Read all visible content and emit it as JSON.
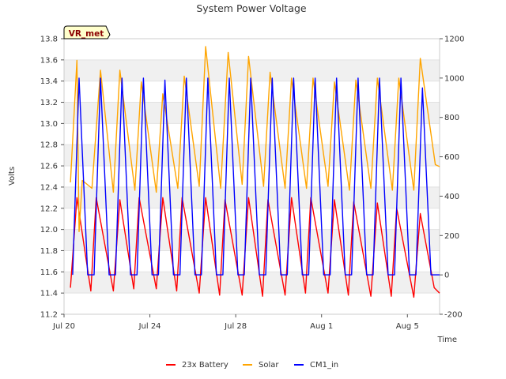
{
  "chart_data": {
    "type": "line",
    "title": "System Power Voltage",
    "xlabel": "Time",
    "ylabel": "Volts",
    "annotation": "VR_met",
    "x_ticks": [
      "Jul 20",
      "Jul 24",
      "Jul 28",
      "Aug 1",
      "Aug 5"
    ],
    "x_tick_days": [
      0,
      4,
      8,
      12,
      16
    ],
    "x_range_days": [
      0,
      17.5
    ],
    "y_left": {
      "range": [
        11.2,
        13.8
      ],
      "ticks": [
        "11.2",
        "11.4",
        "11.6",
        "11.8",
        "12.0",
        "12.2",
        "12.4",
        "12.6",
        "12.8",
        "13.0",
        "13.2",
        "13.4",
        "13.6",
        "13.8"
      ]
    },
    "y_right": {
      "range": [
        -200,
        1200
      ],
      "ticks": [
        "-200",
        "0",
        "200",
        "400",
        "600",
        "800",
        "1000",
        "1200"
      ]
    },
    "grid": "horizontal bands",
    "legend_position": "bottom",
    "series": [
      {
        "name": "23x Battery",
        "axis": "left",
        "color": "#ff0000",
        "x_days": [
          0.3,
          0.6,
          1.25,
          1.5,
          2.3,
          2.6,
          3.25,
          3.5,
          4.3,
          4.6,
          5.25,
          5.5,
          6.3,
          6.6,
          7.25,
          7.5,
          8.3,
          8.6,
          9.25,
          9.5,
          10.3,
          10.6,
          11.25,
          11.5,
          12.3,
          12.6,
          13.25,
          13.5,
          14.3,
          14.6,
          15.25,
          15.5,
          16.3,
          16.6,
          17.25,
          17.5
        ],
        "values": [
          11.45,
          12.3,
          11.42,
          12.3,
          11.42,
          12.28,
          11.44,
          12.3,
          11.44,
          12.3,
          11.42,
          12.3,
          11.4,
          12.3,
          11.38,
          12.28,
          11.38,
          12.3,
          11.37,
          12.28,
          11.38,
          12.3,
          11.4,
          12.3,
          11.4,
          12.28,
          11.38,
          12.26,
          11.37,
          12.25,
          11.37,
          12.2,
          11.36,
          12.15,
          11.45,
          11.4
        ]
      },
      {
        "name": "Solar",
        "axis": "right",
        "color": "#ffa500",
        "x_days": [
          0.3,
          0.6,
          0.7,
          0.85,
          1.3,
          1.7,
          2.3,
          2.6,
          3.3,
          3.6,
          4.3,
          4.6,
          5.3,
          5.6,
          6.3,
          6.6,
          7.3,
          7.65,
          8.3,
          8.6,
          9.3,
          9.6,
          10.3,
          10.6,
          11.3,
          11.6,
          12.3,
          12.6,
          13.3,
          13.6,
          14.3,
          14.6,
          15.3,
          15.6,
          16.3,
          16.6,
          17.3,
          17.5
        ],
        "values": [
          470,
          1090,
          220,
          480,
          440,
          1040,
          420,
          1040,
          430,
          980,
          420,
          920,
          440,
          1010,
          450,
          1160,
          440,
          1130,
          460,
          1110,
          450,
          1030,
          440,
          1000,
          440,
          1000,
          450,
          980,
          430,
          990,
          440,
          1000,
          430,
          1000,
          430,
          1100,
          560,
          550
        ]
      },
      {
        "name": "CM1_in",
        "axis": "right",
        "color": "#0000ff",
        "x_days": [
          0.4,
          0.7,
          1.1,
          1.4,
          1.7,
          2.1,
          2.4,
          2.7,
          3.1,
          3.4,
          3.7,
          4.1,
          4.4,
          4.7,
          5.1,
          5.4,
          5.7,
          6.1,
          6.4,
          6.7,
          7.1,
          7.4,
          7.7,
          8.1,
          8.4,
          8.7,
          9.1,
          9.4,
          9.7,
          10.1,
          10.4,
          10.7,
          11.1,
          11.4,
          11.7,
          12.1,
          12.4,
          12.7,
          13.1,
          13.4,
          13.7,
          14.1,
          14.4,
          14.7,
          15.1,
          15.4,
          15.7,
          16.1,
          16.4,
          16.7,
          17.1,
          17.5
        ],
        "values": [
          0,
          1000,
          0,
          0,
          1000,
          0,
          0,
          1000,
          0,
          0,
          1000,
          0,
          0,
          990,
          0,
          0,
          1000,
          0,
          0,
          1000,
          0,
          0,
          1000,
          0,
          0,
          1000,
          0,
          0,
          1000,
          0,
          0,
          1000,
          0,
          0,
          1000,
          0,
          0,
          1000,
          0,
          0,
          1000,
          0,
          0,
          1000,
          0,
          0,
          1000,
          0,
          0,
          950,
          0,
          0
        ]
      }
    ]
  }
}
